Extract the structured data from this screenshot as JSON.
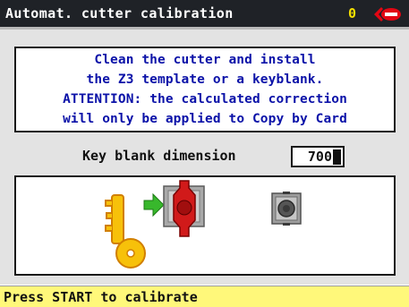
{
  "window": {
    "title": "Automat. cutter calibration",
    "counter": "0",
    "logo_icon": "silca-key-logo-icon"
  },
  "instruction": {
    "lines": [
      "Clean the cutter and install",
      "the Z3 template or a keyblank.",
      "ATTENTION: the calculated correction",
      "will only be applied to Copy by Card"
    ],
    "color": "#0b12a8"
  },
  "key_blank": {
    "label": "Key blank dimension",
    "value": "700"
  },
  "graphic": {
    "icons": [
      "key-icon",
      "arrow-right-icon",
      "red-clamp-icon",
      "gray-clamp-icon"
    ]
  },
  "status": {
    "text": "Press START to calibrate",
    "background": "#fff87a"
  }
}
